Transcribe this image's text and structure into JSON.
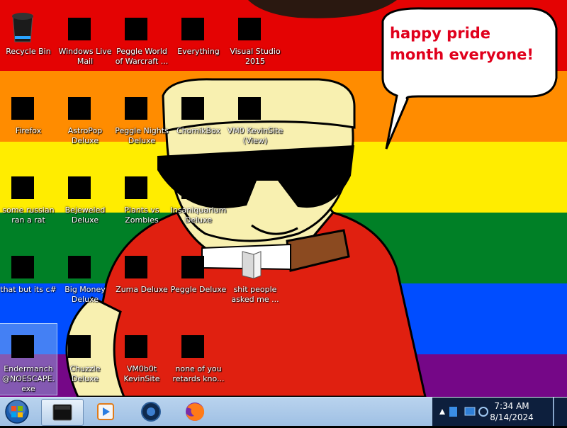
{
  "wallpaper": {
    "bubble_text": "happy pride month everyone!",
    "colors": [
      "#e40303",
      "#ff8c00",
      "#ffed00",
      "#008026",
      "#004dff",
      "#750787"
    ]
  },
  "desktop": {
    "icons": [
      {
        "label": "Recycle Bin",
        "icon": "recycle-bin-icon"
      },
      {
        "label": "Windows Live Mail",
        "icon": "mail-icon"
      },
      {
        "label": "Peggle World of Warcraft ...",
        "icon": "peggle-icon"
      },
      {
        "label": "Everything",
        "icon": "search-app-icon"
      },
      {
        "label": "Visual Studio 2015",
        "icon": "visual-studio-icon"
      },
      {
        "label": "Firefox",
        "icon": "firefox-icon"
      },
      {
        "label": "AstroPop Deluxe",
        "icon": "astropop-icon"
      },
      {
        "label": "Peggle Nights Deluxe",
        "icon": "peggle-nights-icon"
      },
      {
        "label": "ChomikBox",
        "icon": "chomikbox-icon"
      },
      {
        "label": "VM0 KevinSite (View)",
        "icon": "vm-icon"
      },
      {
        "label": "some russian ran a rat",
        "icon": "app-icon"
      },
      {
        "label": "Bejeweled Deluxe",
        "icon": "bejeweled-icon"
      },
      {
        "label": "Plants vs Zombies",
        "icon": "plants-vs-zombies-icon"
      },
      {
        "label": "Insaniquarium Deluxe",
        "icon": "insaniquarium-icon"
      },
      {
        "label": "that but its c#",
        "icon": "folder-icon"
      },
      {
        "label": "Big Money Deluxe",
        "icon": "big-money-icon"
      },
      {
        "label": "Zuma Deluxe",
        "icon": "zuma-icon"
      },
      {
        "label": "Peggle Deluxe",
        "icon": "peggle-deluxe-icon"
      },
      {
        "label": "shit people asked me ...",
        "icon": "document-icon"
      },
      {
        "label": "Endermanch @NOESCAPE. exe",
        "icon": "executable-icon"
      },
      {
        "label": "Chuzzle Deluxe",
        "icon": "chuzzle-icon"
      },
      {
        "label": "VM0b0t KevinSite",
        "icon": "vm-icon"
      },
      {
        "label": "none of you retards kno...",
        "icon": "app-icon"
      }
    ]
  },
  "taskbar": {
    "start": "windows-orb-icon",
    "pinned": [
      "terminal-icon",
      "media-player-icon",
      "app-icon",
      "firefox-icon"
    ],
    "tray_icons": [
      "flag-icon",
      "network-icon",
      "volume-icon"
    ],
    "time": "7:34 AM",
    "date": "8/14/2024"
  }
}
